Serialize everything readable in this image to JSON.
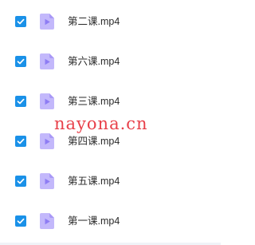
{
  "files": [
    {
      "name": "第二课.mp4",
      "checked": true,
      "icon": "video-file-icon"
    },
    {
      "name": "第六课.mp4",
      "checked": true,
      "icon": "video-file-icon"
    },
    {
      "name": "第三课.mp4",
      "checked": true,
      "icon": "video-file-icon"
    },
    {
      "name": "第四课.mp4",
      "checked": true,
      "icon": "video-file-icon"
    },
    {
      "name": "第五课.mp4",
      "checked": true,
      "icon": "video-file-icon"
    },
    {
      "name": "第一课.mp4",
      "checked": true,
      "icon": "video-file-icon"
    }
  ],
  "watermark": "nayona.cn",
  "colors": {
    "checkbox": "#1a91e8",
    "file_icon_light": "#c3b8fb",
    "file_icon_dark": "#8e7cf4",
    "watermark": "#e8404a",
    "text": "#2a2a2a"
  }
}
